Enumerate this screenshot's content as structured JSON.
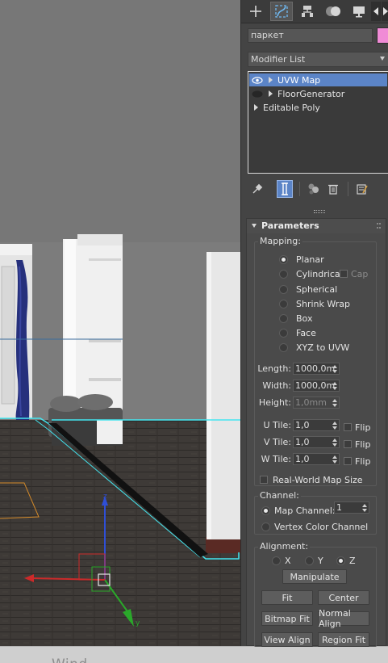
{
  "viewport": {
    "bottom_text": "Wind..."
  },
  "command_panel": {
    "tabs": [
      {
        "name": "create-tab",
        "icon": "plus-icon"
      },
      {
        "name": "modify-tab",
        "icon": "modify-bend-icon",
        "active": true
      },
      {
        "name": "hierarchy-tab",
        "icon": "hierarchy-icon"
      },
      {
        "name": "motion-tab",
        "icon": "motion-circles-icon"
      },
      {
        "name": "display-tab",
        "icon": "display-monitor-icon"
      }
    ],
    "object_name": "паркет",
    "object_color": "#f08bd6",
    "modifier_list_label": "Modifier List",
    "stack": [
      {
        "label": "UVW Map",
        "selected": true,
        "visible_eye": true
      },
      {
        "label": "FloorGenerator",
        "selected": false,
        "visible_eye": true
      },
      {
        "label": "Editable Poly",
        "selected": false,
        "visible_eye": false
      }
    ],
    "stack_tools": [
      "pin-stack-icon",
      "show-end-result-icon",
      "make-unique-icon",
      "remove-modifier-icon",
      "configure-sets-icon"
    ]
  },
  "parameters": {
    "rollout_title": "Parameters",
    "mapping": {
      "label": "Mapping:",
      "options": [
        "Planar",
        "Cylindrical",
        "Spherical",
        "Shrink Wrap",
        "Box",
        "Face",
        "XYZ to UVW"
      ],
      "selected": "Planar",
      "cap_label": "Cap"
    },
    "size": {
      "length_label": "Length:",
      "length_value": "1000,0m",
      "width_label": "Width:",
      "width_value": "1000,0m",
      "height_label": "Height:",
      "height_value": "1,0mm"
    },
    "tile": {
      "u_label": "U Tile:",
      "u_value": "1,0",
      "v_label": "V Tile:",
      "v_value": "1,0",
      "w_label": "W Tile:",
      "w_value": "1,0",
      "flip_label": "Flip"
    },
    "real_world_label": "Real-World Map Size",
    "channel": {
      "label": "Channel:",
      "map_channel_label": "Map Channel:",
      "map_channel_value": "1",
      "vertex_color_label": "Vertex Color Channel",
      "selected": "Map Channel"
    },
    "alignment": {
      "label": "Alignment:",
      "axes": [
        "X",
        "Y",
        "Z"
      ],
      "selected_axis": "Z",
      "manipulate_label": "Manipulate",
      "fit_label": "Fit",
      "center_label": "Center",
      "bitmap_fit_label": "Bitmap Fit",
      "normal_align_label": "Normal Align",
      "view_align_label": "View Align",
      "region_fit_label": "Region Fit"
    }
  }
}
